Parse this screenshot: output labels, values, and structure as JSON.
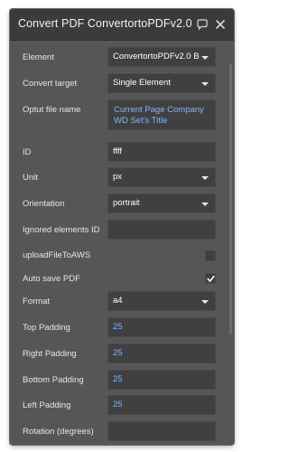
{
  "window": {
    "title": "Convert PDF ConvertortoPDFv2.0",
    "comment_icon": "comment-icon",
    "close_icon": "close-icon"
  },
  "fields": {
    "element": {
      "label": "Element",
      "value": "ConvertortoPDFv2.0 B"
    },
    "convert_target": {
      "label": "Convert target",
      "value": "Single Element"
    },
    "output_file_name": {
      "label": "Optut file name",
      "line1": "Current Page Company",
      "line2": "WD Set's Title"
    },
    "id": {
      "label": "ID",
      "value": "ffff"
    },
    "unit": {
      "label": "Unit",
      "value": "px"
    },
    "orientation": {
      "label": "Orientation",
      "value": "portrait"
    },
    "ignored_elements_id": {
      "label": "Ignored elements ID",
      "value": ""
    },
    "upload_to_aws": {
      "label": "uploadFileToAWS",
      "checked": false
    },
    "auto_save_pdf": {
      "label": "Auto save PDF",
      "checked": true
    },
    "format": {
      "label": "Format",
      "value": "a4"
    },
    "top_padding": {
      "label": "Top Padding",
      "value": "25"
    },
    "right_padding": {
      "label": "Right Padding",
      "value": "25"
    },
    "bottom_padding": {
      "label": "Bottom Padding",
      "value": "25"
    },
    "left_padding": {
      "label": "Left Padding",
      "value": "25"
    },
    "rotation": {
      "label": "Rotation (degrees)",
      "value": ""
    }
  },
  "colors": {
    "panel_bg": "#565656",
    "titlebar_bg": "#3b3b3b",
    "field_bg": "#404040",
    "dynamic_text": "#7fb6ff"
  }
}
